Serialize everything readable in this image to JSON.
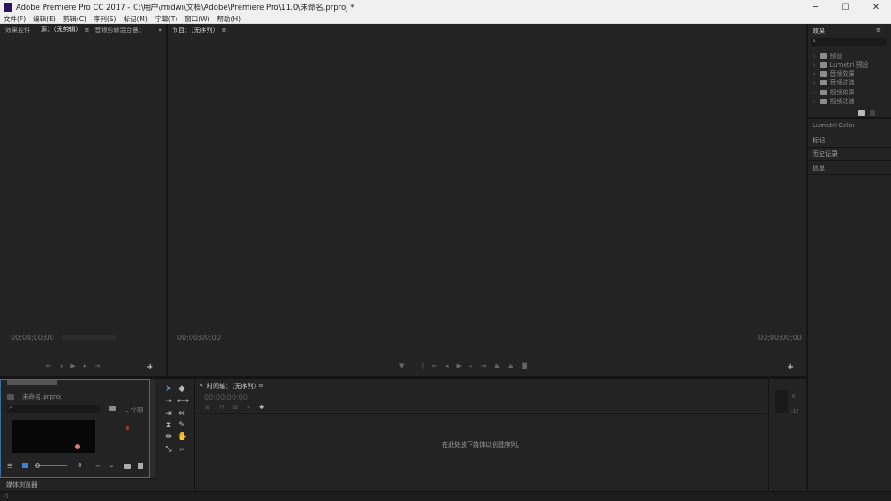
{
  "window": {
    "title": "Adobe Premiere Pro CC 2017 - C:\\用户\\midwi\\文档\\Adobe\\Premiere Pro\\11.0\\未命名.prproj *",
    "minimize": "─",
    "maximize": "☐",
    "close": "✕"
  },
  "menu": [
    "文件(F)",
    "编辑(E)",
    "剪辑(C)",
    "序列(S)",
    "标记(M)",
    "字幕(T)",
    "窗口(W)",
    "帮助(H)"
  ],
  "source_panel": {
    "tabs": [
      "效果控件",
      "源：（无剪辑）",
      "音频剪辑混合器："
    ],
    "more": "»",
    "timecode_in": "00;00;00;00",
    "add": "+"
  },
  "program_panel": {
    "title": "节目：（无序列）",
    "timecode_left": "00;00;00;00",
    "timecode_right": "00;00;00;00",
    "add": "+"
  },
  "project_panel": {
    "filename": "未命名.prproj",
    "count": "1 个项",
    "tab_label": "媒体浏览器"
  },
  "timeline": {
    "title": "时间轴：（无序列）",
    "timecode": "00;00;00;00",
    "hint": "在此处放下媒体以创建序列。"
  },
  "effects_panel": {
    "title": "效果",
    "items": [
      "预设",
      "Lumetri 预设",
      "音频效果",
      "音频过渡",
      "视频效果",
      "视频过渡"
    ],
    "sections": [
      "Lumetri Color",
      "标记",
      "历史记录",
      "信息"
    ]
  },
  "meter": {
    "ticks": [
      "0",
      "-12"
    ]
  }
}
